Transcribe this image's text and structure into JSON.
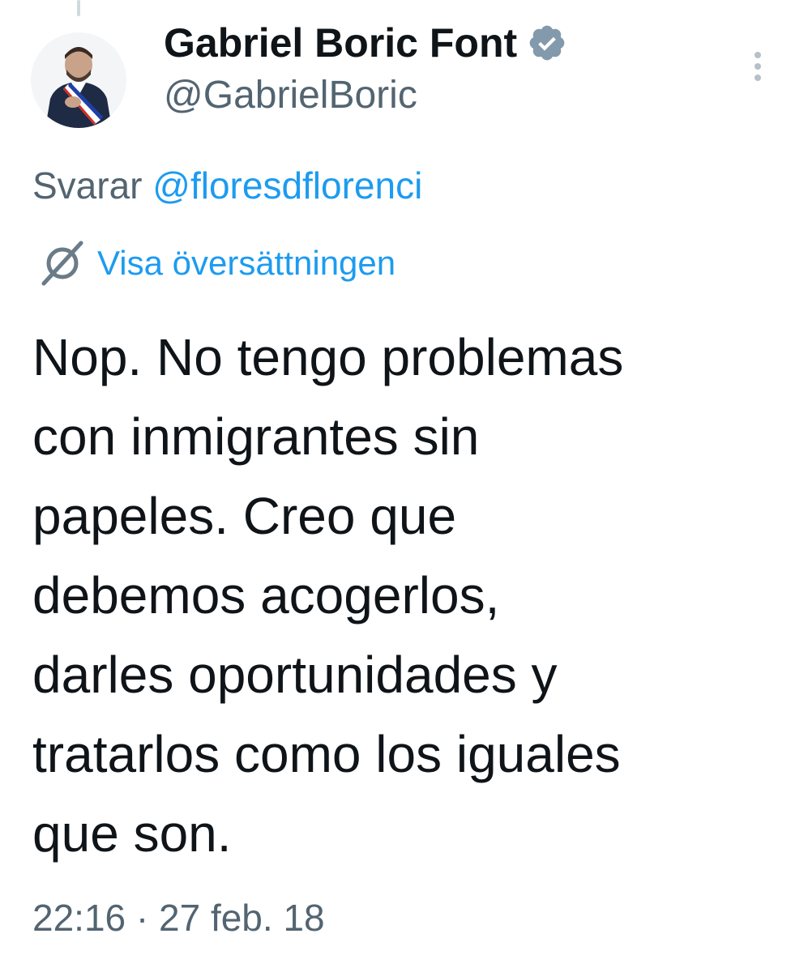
{
  "tweet": {
    "author": {
      "display_name": "Gabriel Boric Font",
      "handle": "@GabrielBoric",
      "verified": true,
      "avatar_icon": "profile-photo"
    },
    "reply": {
      "prefix": "Svarar",
      "mention": "@floresdflorenci"
    },
    "translate_label": "Visa översättningen",
    "text": "Nop. No tengo problemas\ncon inmigrantes sin\npapeles. Creo que\ndebemos acogerlos,\ndarles oportunidades y\ntratarlos como los iguales\nque son.",
    "timestamp": "22:16 · 27 feb. 18"
  },
  "colors": {
    "primary_text": "#0f1419",
    "secondary_text": "#536471",
    "link": "#1d9bf0",
    "badge": "#829aab"
  },
  "icons": {
    "verified": "verified-badge-icon",
    "translate": "translate-icon",
    "more": "more-options-icon"
  }
}
